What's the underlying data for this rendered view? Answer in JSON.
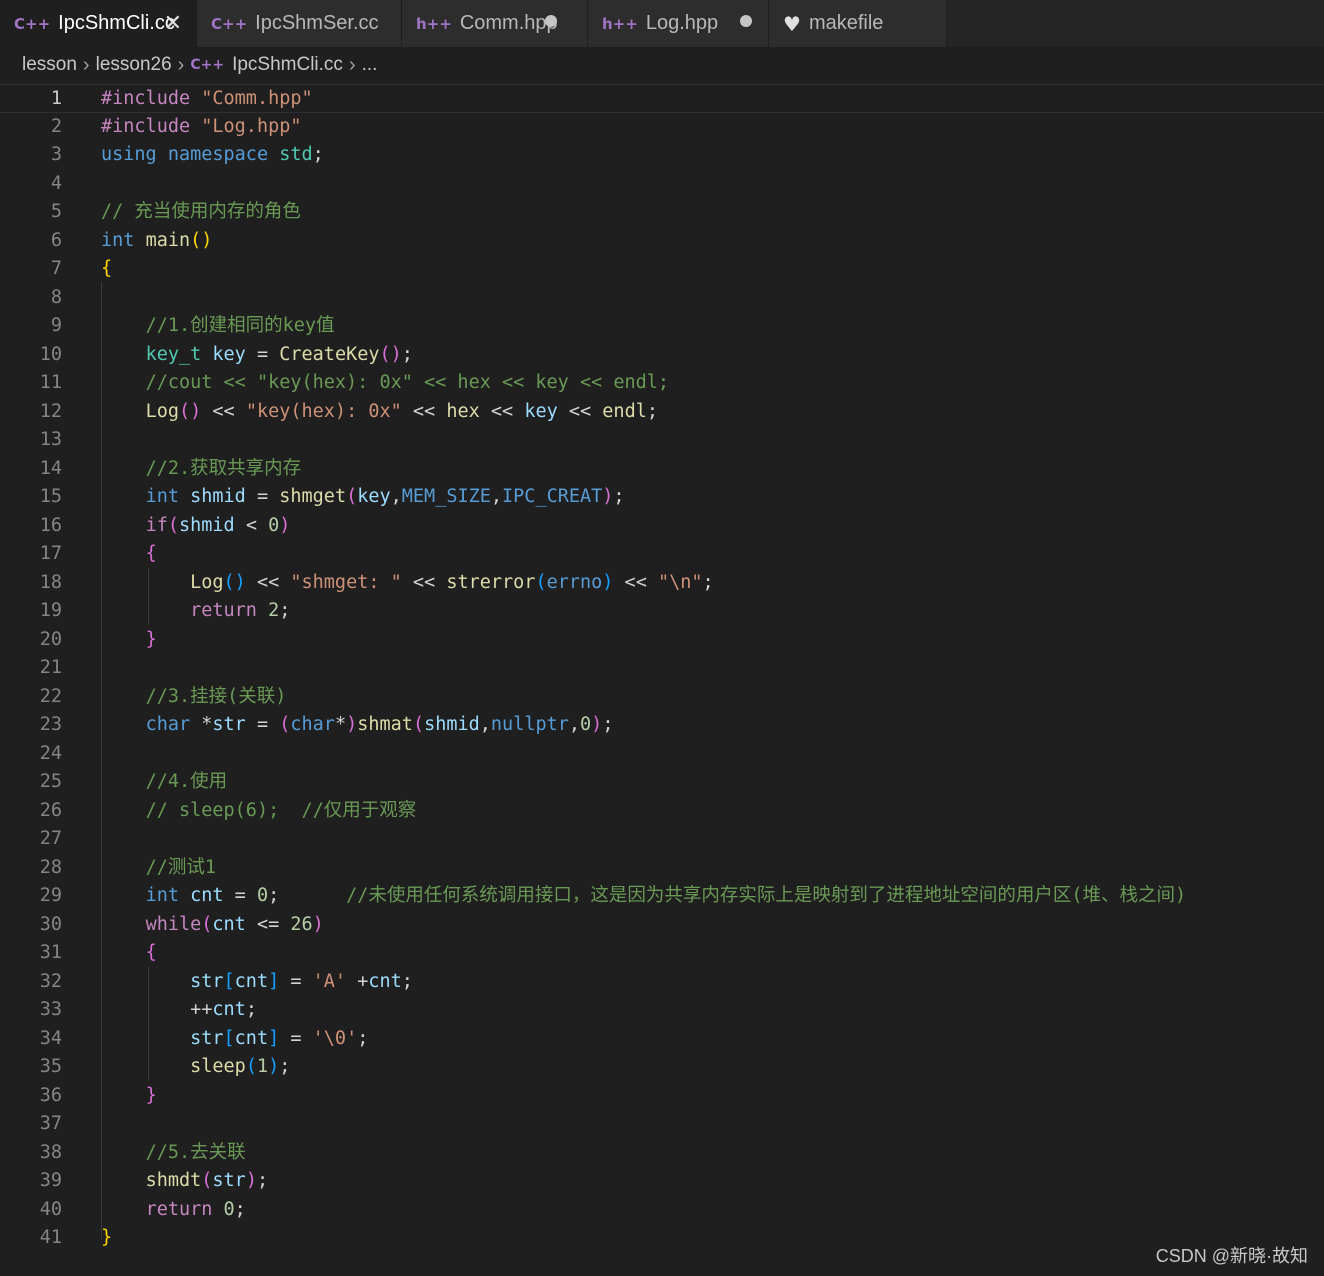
{
  "tabs": [
    {
      "icon": "C++",
      "icon_name": "cpp-file-icon",
      "label": "IpcShmCli.cc",
      "active": true,
      "close": "✕",
      "dirty": false
    },
    {
      "icon": "C++",
      "icon_name": "cpp-file-icon",
      "label": "IpcShmSer.cc",
      "active": false,
      "dirty": false
    },
    {
      "icon": "h++",
      "icon_name": "header-file-icon",
      "label": "Comm.hpp",
      "active": false,
      "dirty": true
    },
    {
      "icon": "h++",
      "icon_name": "header-file-icon",
      "label": "Log.hpp",
      "active": false,
      "dirty": true
    },
    {
      "icon": "♥",
      "icon_name": "makefile-icon",
      "label": "makefile",
      "active": false,
      "dirty": false
    }
  ],
  "breadcrumb": {
    "items": [
      "lesson",
      "lesson26",
      "IpcShmCli.cc",
      "..."
    ],
    "separator": "›",
    "file_icon": "C++"
  },
  "editor": {
    "current_line": 1,
    "lines": [
      {
        "n": "1",
        "t": [
          [
            "kw",
            "#include"
          ],
          [
            "op",
            " "
          ],
          [
            "str",
            "\"Comm.hpp\""
          ]
        ]
      },
      {
        "n": "2",
        "t": [
          [
            "kw",
            "#include"
          ],
          [
            "op",
            " "
          ],
          [
            "str",
            "\"Log.hpp\""
          ]
        ]
      },
      {
        "n": "3",
        "t": [
          [
            "ty",
            "using"
          ],
          [
            "op",
            " "
          ],
          [
            "ty",
            "namespace"
          ],
          [
            "op",
            " "
          ],
          [
            "nsp",
            "std"
          ],
          [
            "op",
            ";"
          ]
        ]
      },
      {
        "n": "4",
        "t": []
      },
      {
        "n": "5",
        "t": [
          [
            "cm",
            "// 充当使用内存的角色"
          ]
        ]
      },
      {
        "n": "6",
        "t": [
          [
            "ty",
            "int"
          ],
          [
            "op",
            " "
          ],
          [
            "fn",
            "main"
          ],
          [
            "br1",
            "()"
          ]
        ]
      },
      {
        "n": "7",
        "t": [
          [
            "br1",
            "{"
          ]
        ]
      },
      {
        "n": "8",
        "t": []
      },
      {
        "n": "9",
        "t": [
          [
            "op",
            "    "
          ],
          [
            "cm",
            "//1.创建相同的key值"
          ]
        ]
      },
      {
        "n": "10",
        "t": [
          [
            "op",
            "    "
          ],
          [
            "nsp",
            "key_t"
          ],
          [
            "op",
            " "
          ],
          [
            "var",
            "key"
          ],
          [
            "op",
            " = "
          ],
          [
            "fn",
            "CreateKey"
          ],
          [
            "br2",
            "()"
          ],
          [
            "op",
            ";"
          ]
        ]
      },
      {
        "n": "11",
        "t": [
          [
            "op",
            "    "
          ],
          [
            "cm",
            "//cout << \"key(hex): 0x\" << hex << key << endl;"
          ]
        ]
      },
      {
        "n": "12",
        "t": [
          [
            "op",
            "    "
          ],
          [
            "fn",
            "Log"
          ],
          [
            "br2",
            "()"
          ],
          [
            "op",
            " << "
          ],
          [
            "str",
            "\"key(hex): 0x\""
          ],
          [
            "op",
            " << "
          ],
          [
            "fn",
            "hex"
          ],
          [
            "op",
            " << "
          ],
          [
            "var",
            "key"
          ],
          [
            "op",
            " << "
          ],
          [
            "fn",
            "endl"
          ],
          [
            "op",
            ";"
          ]
        ]
      },
      {
        "n": "13",
        "t": []
      },
      {
        "n": "14",
        "t": [
          [
            "op",
            "    "
          ],
          [
            "cm",
            "//2.获取共享内存"
          ]
        ]
      },
      {
        "n": "15",
        "t": [
          [
            "op",
            "    "
          ],
          [
            "ty",
            "int"
          ],
          [
            "op",
            " "
          ],
          [
            "var",
            "shmid"
          ],
          [
            "op",
            " = "
          ],
          [
            "fn",
            "shmget"
          ],
          [
            "br2",
            "("
          ],
          [
            "var",
            "key"
          ],
          [
            "op",
            ","
          ],
          [
            "mac",
            "MEM_SIZE"
          ],
          [
            "op",
            ","
          ],
          [
            "mac",
            "IPC_CREAT"
          ],
          [
            "br2",
            ")"
          ],
          [
            "op",
            ";"
          ]
        ]
      },
      {
        "n": "16",
        "t": [
          [
            "op",
            "    "
          ],
          [
            "kw",
            "if"
          ],
          [
            "br2",
            "("
          ],
          [
            "var",
            "shmid"
          ],
          [
            "op",
            " < "
          ],
          [
            "num",
            "0"
          ],
          [
            "br2",
            ")"
          ]
        ]
      },
      {
        "n": "17",
        "t": [
          [
            "op",
            "    "
          ],
          [
            "br2",
            "{"
          ]
        ]
      },
      {
        "n": "18",
        "t": [
          [
            "op",
            "        "
          ],
          [
            "fn",
            "Log"
          ],
          [
            "br3",
            "()"
          ],
          [
            "op",
            " << "
          ],
          [
            "str",
            "\"shmget: \""
          ],
          [
            "op",
            " << "
          ],
          [
            "fn",
            "strerror"
          ],
          [
            "br3",
            "("
          ],
          [
            "mac",
            "errno"
          ],
          [
            "br3",
            ")"
          ],
          [
            "op",
            " << "
          ],
          [
            "str",
            "\"\\n\""
          ],
          [
            "op",
            ";"
          ]
        ]
      },
      {
        "n": "19",
        "t": [
          [
            "op",
            "        "
          ],
          [
            "kw",
            "return"
          ],
          [
            "op",
            " "
          ],
          [
            "num",
            "2"
          ],
          [
            "op",
            ";"
          ]
        ]
      },
      {
        "n": "20",
        "t": [
          [
            "op",
            "    "
          ],
          [
            "br2",
            "}"
          ]
        ]
      },
      {
        "n": "21",
        "t": []
      },
      {
        "n": "22",
        "t": [
          [
            "op",
            "    "
          ],
          [
            "cm",
            "//3.挂接(关联)"
          ]
        ]
      },
      {
        "n": "23",
        "t": [
          [
            "op",
            "    "
          ],
          [
            "ty",
            "char"
          ],
          [
            "op",
            " *"
          ],
          [
            "var",
            "str"
          ],
          [
            "op",
            " = "
          ],
          [
            "br2",
            "("
          ],
          [
            "ty",
            "char"
          ],
          [
            "op",
            "*"
          ],
          [
            "br2",
            ")"
          ],
          [
            "fn",
            "shmat"
          ],
          [
            "br2",
            "("
          ],
          [
            "var",
            "shmid"
          ],
          [
            "op",
            ","
          ],
          [
            "ty",
            "nullptr"
          ],
          [
            "op",
            ","
          ],
          [
            "num",
            "0"
          ],
          [
            "br2",
            ")"
          ],
          [
            "op",
            ";"
          ]
        ]
      },
      {
        "n": "24",
        "t": []
      },
      {
        "n": "25",
        "t": [
          [
            "op",
            "    "
          ],
          [
            "cm",
            "//4.使用"
          ]
        ]
      },
      {
        "n": "26",
        "t": [
          [
            "op",
            "    "
          ],
          [
            "cm",
            "// sleep(6);  //仅用于观察"
          ]
        ]
      },
      {
        "n": "27",
        "t": []
      },
      {
        "n": "28",
        "t": [
          [
            "op",
            "    "
          ],
          [
            "cm",
            "//测试1"
          ]
        ]
      },
      {
        "n": "29",
        "t": [
          [
            "op",
            "    "
          ],
          [
            "ty",
            "int"
          ],
          [
            "op",
            " "
          ],
          [
            "var",
            "cnt"
          ],
          [
            "op",
            " = "
          ],
          [
            "num",
            "0"
          ],
          [
            "op",
            ";      "
          ],
          [
            "cm",
            "//未使用任何系统调用接口，这是因为共享内存实际上是映射到了进程地址空间的用户区(堆、栈之间)"
          ]
        ]
      },
      {
        "n": "30",
        "t": [
          [
            "op",
            "    "
          ],
          [
            "kw",
            "while"
          ],
          [
            "br2",
            "("
          ],
          [
            "var",
            "cnt"
          ],
          [
            "op",
            " <= "
          ],
          [
            "num",
            "26"
          ],
          [
            "br2",
            ")"
          ]
        ]
      },
      {
        "n": "31",
        "t": [
          [
            "op",
            "    "
          ],
          [
            "br2",
            "{"
          ]
        ]
      },
      {
        "n": "32",
        "t": [
          [
            "op",
            "        "
          ],
          [
            "var",
            "str"
          ],
          [
            "br3",
            "["
          ],
          [
            "var",
            "cnt"
          ],
          [
            "br3",
            "]"
          ],
          [
            "op",
            " = "
          ],
          [
            "str",
            "'A'"
          ],
          [
            "op",
            " +"
          ],
          [
            "var",
            "cnt"
          ],
          [
            "op",
            ";"
          ]
        ]
      },
      {
        "n": "33",
        "t": [
          [
            "op",
            "        ++"
          ],
          [
            "var",
            "cnt"
          ],
          [
            "op",
            ";"
          ]
        ]
      },
      {
        "n": "34",
        "t": [
          [
            "op",
            "        "
          ],
          [
            "var",
            "str"
          ],
          [
            "br3",
            "["
          ],
          [
            "var",
            "cnt"
          ],
          [
            "br3",
            "]"
          ],
          [
            "op",
            " = "
          ],
          [
            "str",
            "'\\0'"
          ],
          [
            "op",
            ";"
          ]
        ]
      },
      {
        "n": "35",
        "t": [
          [
            "op",
            "        "
          ],
          [
            "fn",
            "sleep"
          ],
          [
            "br3",
            "("
          ],
          [
            "num",
            "1"
          ],
          [
            "br3",
            ")"
          ],
          [
            "op",
            ";"
          ]
        ]
      },
      {
        "n": "36",
        "t": [
          [
            "op",
            "    "
          ],
          [
            "br2",
            "}"
          ]
        ]
      },
      {
        "n": "37",
        "t": []
      },
      {
        "n": "38",
        "t": [
          [
            "op",
            "    "
          ],
          [
            "cm",
            "//5.去关联"
          ]
        ]
      },
      {
        "n": "39",
        "t": [
          [
            "op",
            "    "
          ],
          [
            "fn",
            "shmdt"
          ],
          [
            "br2",
            "("
          ],
          [
            "var",
            "str"
          ],
          [
            "br2",
            ")"
          ],
          [
            "op",
            ";"
          ]
        ]
      },
      {
        "n": "40",
        "t": [
          [
            "op",
            "    "
          ],
          [
            "kw",
            "return"
          ],
          [
            "op",
            " "
          ],
          [
            "num",
            "0"
          ],
          [
            "op",
            ";"
          ]
        ]
      },
      {
        "n": "41",
        "t": [
          [
            "br1",
            "}"
          ]
        ]
      }
    ]
  },
  "watermark": "CSDN @新晓·故知",
  "colors": {
    "background": "#1f1f1f",
    "keyword": "#c586c0",
    "type": "#569cd6",
    "function": "#dcdcaa",
    "variable": "#9cdcfe",
    "string": "#ce9178",
    "number": "#b5cea8",
    "comment": "#6a9955"
  }
}
